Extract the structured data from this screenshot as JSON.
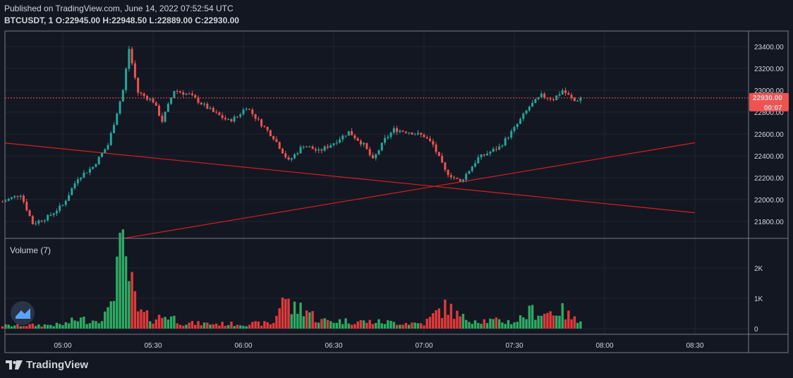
{
  "header": {
    "published": "Published on TradingView.com, June 14, 2022 07:52:54 UTC",
    "symbol": "BTCUSDT, 1",
    "open": "O:22945.00",
    "high": "H:22948.50",
    "low": "L:22889.00",
    "close": "C:22930.00"
  },
  "price_tag": {
    "value": "22930.00",
    "countdown": "00:07"
  },
  "volume_label": "Volume (7)",
  "brand": "TradingView",
  "colors": {
    "background": "#131722",
    "up": "#26a69a",
    "down": "#ef5350",
    "up_volume": "#2eaa62",
    "down_volume": "#e03a3a",
    "trendline": "#d81e1e",
    "grid": "#222632",
    "text": "#d1d4dc"
  },
  "icons": {
    "logo": "tradingview-logo-icon",
    "badge": "tradingview-cloud-icon"
  },
  "chart_data": {
    "type": "candlestick",
    "interval": "1m",
    "x_ticks": [
      "05:00",
      "05:30",
      "06:00",
      "06:30",
      "07:00",
      "07:30",
      "08:00",
      "08:30"
    ],
    "y_ticks": [
      "21800.00",
      "22000.00",
      "22200.00",
      "22400.00",
      "22600.00",
      "22800.00",
      "23000.00",
      "23200.00",
      "23400.00"
    ],
    "ylim": [
      21650,
      23520
    ],
    "volume_ticks": [
      "0",
      "1K",
      "2K"
    ],
    "volume_ylim": [
      0,
      2800
    ],
    "time_start": "04:40",
    "time_end": "07:52",
    "last_close": 22930,
    "price_path": [
      [
        "04:40",
        21980
      ],
      [
        "04:46",
        22050
      ],
      [
        "04:50",
        21780
      ],
      [
        "04:55",
        21840
      ],
      [
        "05:00",
        21950
      ],
      [
        "05:05",
        22200
      ],
      [
        "05:10",
        22300
      ],
      [
        "05:15",
        22500
      ],
      [
        "05:18",
        22800
      ],
      [
        "05:20",
        23000
      ],
      [
        "05:22",
        23380
      ],
      [
        "05:25",
        22980
      ],
      [
        "05:30",
        22900
      ],
      [
        "05:33",
        22720
      ],
      [
        "05:37",
        23000
      ],
      [
        "05:42",
        22960
      ],
      [
        "05:45",
        22900
      ],
      [
        "05:50",
        22800
      ],
      [
        "05:55",
        22720
      ],
      [
        "05:58",
        22760
      ],
      [
        "06:01",
        22850
      ],
      [
        "06:05",
        22720
      ],
      [
        "06:10",
        22570
      ],
      [
        "06:15",
        22350
      ],
      [
        "06:20",
        22500
      ],
      [
        "06:25",
        22440
      ],
      [
        "06:30",
        22520
      ],
      [
        "06:35",
        22620
      ],
      [
        "06:40",
        22500
      ],
      [
        "06:43",
        22360
      ],
      [
        "06:47",
        22550
      ],
      [
        "06:50",
        22640
      ],
      [
        "06:55",
        22620
      ],
      [
        "07:00",
        22580
      ],
      [
        "07:03",
        22500
      ],
      [
        "07:07",
        22260
      ],
      [
        "07:12",
        22160
      ],
      [
        "07:18",
        22380
      ],
      [
        "07:25",
        22480
      ],
      [
        "07:30",
        22650
      ],
      [
        "07:35",
        22850
      ],
      [
        "07:39",
        22950
      ],
      [
        "07:43",
        22920
      ],
      [
        "07:46",
        23000
      ],
      [
        "07:50",
        22900
      ],
      [
        "07:52",
        22930
      ]
    ],
    "volume_profile": [
      [
        "04:40",
        110
      ],
      [
        "05:00",
        150
      ],
      [
        "05:05",
        350
      ],
      [
        "05:10",
        300
      ],
      [
        "05:15",
        550
      ],
      [
        "05:18",
        2400
      ],
      [
        "05:20",
        2600
      ],
      [
        "05:22",
        1900
      ],
      [
        "05:25",
        600
      ],
      [
        "05:30",
        350
      ],
      [
        "05:35",
        500
      ],
      [
        "05:40",
        200
      ],
      [
        "05:50",
        180
      ],
      [
        "06:00",
        170
      ],
      [
        "06:10",
        200
      ],
      [
        "06:13",
        1250
      ],
      [
        "06:16",
        700
      ],
      [
        "06:20",
        800
      ],
      [
        "06:25",
        300
      ],
      [
        "06:40",
        260
      ],
      [
        "07:00",
        190
      ],
      [
        "07:05",
        650
      ],
      [
        "07:08",
        800
      ],
      [
        "07:12",
        400
      ],
      [
        "07:20",
        300
      ],
      [
        "07:30",
        250
      ],
      [
        "07:36",
        650
      ],
      [
        "07:40",
        550
      ],
      [
        "07:45",
        700
      ],
      [
        "07:52",
        180
      ]
    ],
    "trendlines": [
      {
        "from": [
          "04:40",
          22520
        ],
        "to": [
          "08:30",
          21880
        ]
      },
      {
        "from": [
          "05:19",
          21640
        ],
        "to": [
          "08:30",
          22520
        ]
      }
    ]
  }
}
